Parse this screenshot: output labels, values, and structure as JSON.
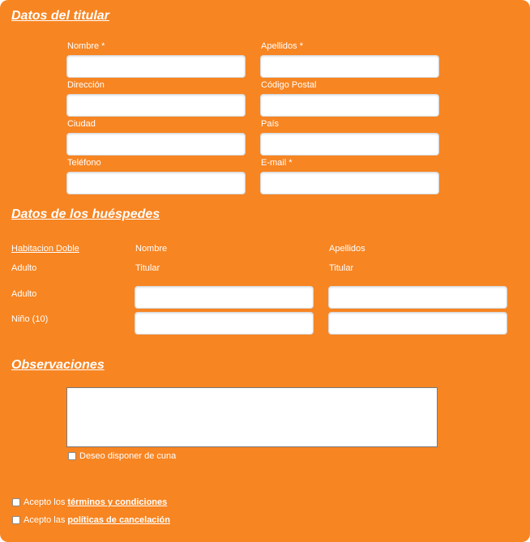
{
  "titular": {
    "title": "Datos del titular",
    "fields": {
      "nombre": {
        "label": "Nombre *",
        "value": ""
      },
      "apellidos": {
        "label": "Apellidos *",
        "value": ""
      },
      "direccion": {
        "label": "Dirección",
        "value": ""
      },
      "codigo_postal": {
        "label": "Código Postal",
        "value": ""
      },
      "ciudad": {
        "label": "Ciudad",
        "value": ""
      },
      "pais": {
        "label": "País",
        "value": ""
      },
      "telefono": {
        "label": "Teléfono",
        "value": ""
      },
      "email": {
        "label": "E-mail *",
        "value": ""
      }
    }
  },
  "huespedes": {
    "title": "Datos de los huéspedes",
    "room_link": "Habitacion Doble",
    "col_nombre": "Nombre",
    "col_apellidos": "Apellidos",
    "rows": [
      {
        "type": "Adulto",
        "nombre_text": "Titular",
        "apellidos_text": "Titular"
      },
      {
        "type": "Adulto"
      },
      {
        "type": "Niño (10)"
      }
    ]
  },
  "observaciones": {
    "title": "Observaciones",
    "text": "",
    "cuna_label": "Deseo disponer de cuna"
  },
  "legal": {
    "terms_prefix": "Acepto los",
    "terms_link": "términos y condiciones",
    "cancel_prefix": "Acepto las",
    "cancel_link": "políticas de cancelación"
  },
  "colors": {
    "panel_background": "#f78522",
    "text": "#ffffff"
  }
}
